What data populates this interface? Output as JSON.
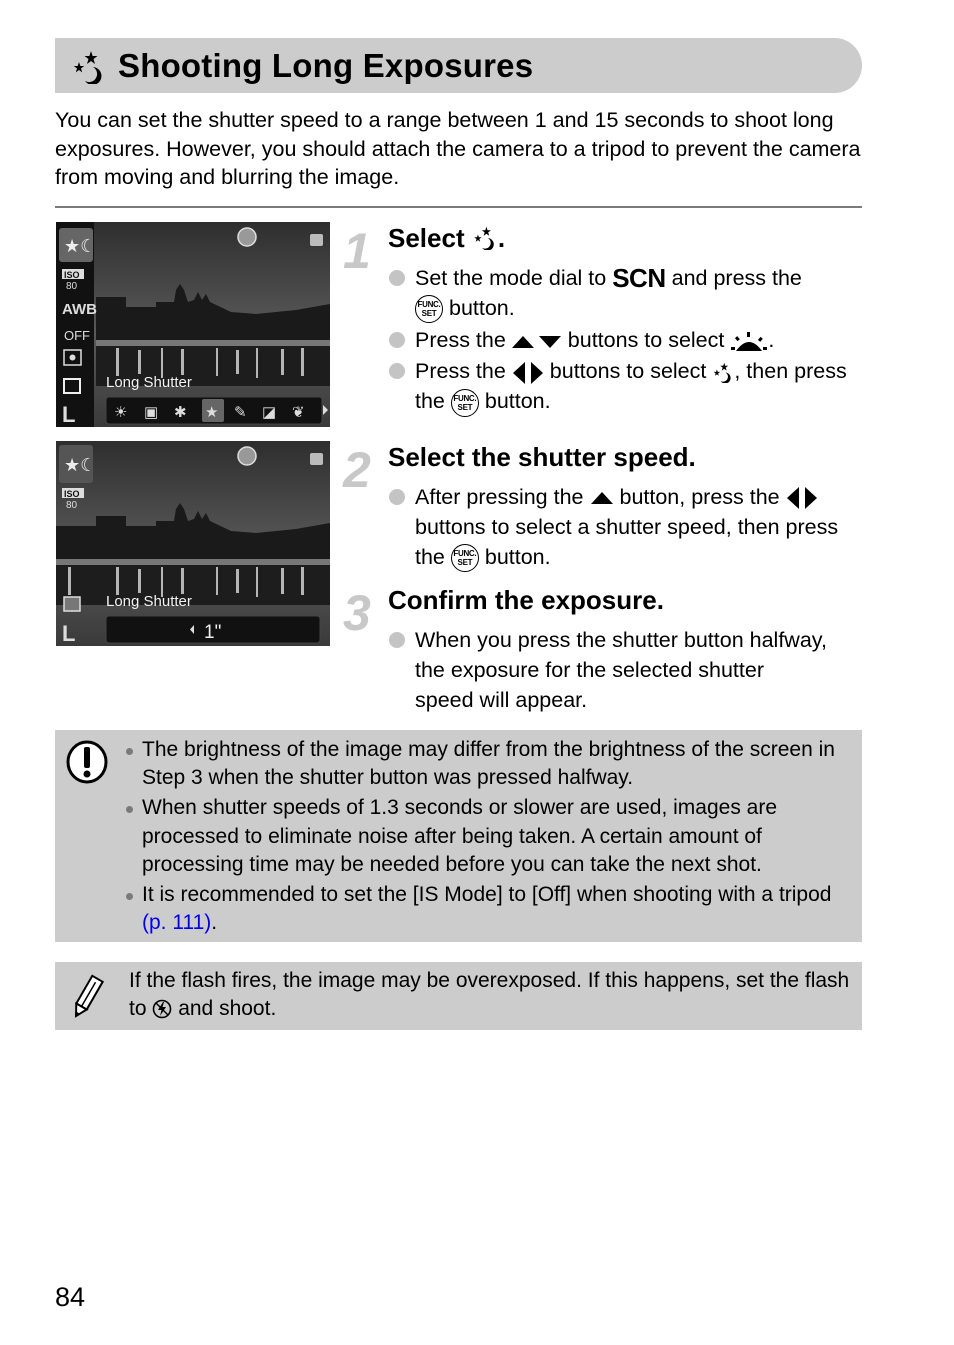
{
  "header": {
    "title_icon": "long-shutter-icon",
    "title": "Shooting Long Exposures"
  },
  "intro": "You can set the shutter speed to a range between 1 and 15 seconds to shoot long exposures. However, you should attach the camera to a tripod to prevent the camera from moving and blurring the image.",
  "screens": [
    {
      "mode_label": "Long Shutter",
      "left_icons": [
        "long-shutter-mode-icon",
        "iso-icon",
        "awb-icon",
        "my-colors-off-icon",
        "metering-icon",
        "drive-mode-icon",
        "image-size-icon"
      ],
      "iso_label": "ISO",
      "iso_value": "80",
      "awb_label": "AWB",
      "my_colors_label": "OFF",
      "size_label": "L",
      "scene_icons": [
        "sunset-icon",
        "portrait-icon",
        "fireworks-icon",
        "long-shutter-icon",
        "foliage-rain-icon",
        "aquarium-icon",
        "foliage-icon"
      ],
      "selected_scene": 3
    },
    {
      "mode_label": "Long Shutter",
      "iso_label": "ISO",
      "iso_value": "80",
      "size_label": "L",
      "shutter_value": "1\""
    }
  ],
  "steps": [
    {
      "number": "1",
      "title": "Select",
      "title_suffix": ".",
      "bullets": [
        {
          "parts": [
            "Set the mode dial to ",
            "SCN",
            " and press the ",
            "FUNC/SET",
            " button."
          ]
        },
        {
          "parts": [
            "Press the ",
            "up-down",
            " buttons to select ",
            "sunset",
            "."
          ]
        },
        {
          "parts": [
            "Press the ",
            "left-right",
            " buttons to select ",
            "long-shutter",
            ", then press the ",
            "FUNC/SET",
            " button."
          ]
        }
      ],
      "text": {
        "b1a": "Set the mode dial to",
        "b1_scn": "SCN",
        "b1b": "and press the",
        "b1c": "button.",
        "b2a": "Press the",
        "b2b": "buttons to select",
        "b2c": ".",
        "b3a": "Press the",
        "b3b": "buttons to select",
        "b3c": ", then press the",
        "b3d": "button."
      }
    },
    {
      "number": "2",
      "title": "Select the shutter speed.",
      "text": {
        "b1a": "After pressing the",
        "b1b": "button, press the",
        "b1c": "buttons to select a shutter speed, then press the",
        "b1d": "button."
      }
    },
    {
      "number": "3",
      "title": "Confirm the exposure.",
      "text": {
        "b1": "When you press the shutter button halfway, the exposure for the selected shutter speed will appear."
      }
    }
  ],
  "func_label_top": "FUNC.",
  "func_label_bottom": "SET",
  "caution": {
    "icon": "caution-icon",
    "items": [
      "The brightness of the image may differ from the brightness of the screen in Step 3 when the shutter button was pressed halfway.",
      "When shutter speeds of 1.3 seconds or slower are used, images are processed to eliminate noise after being taken. A certain amount of processing time may be needed before you can take the next shot.",
      "It is recommended to set the [IS Mode] to [Off] when shooting with a tripod"
    ],
    "link_text": "(p. 111)",
    "link_suffix": ".",
    "link_color": "#0000ee"
  },
  "note": {
    "icon": "pencil-icon",
    "text_a": "If the flash fires, the image may be overexposed. If this happens, set the flash to",
    "text_b": "and shoot."
  },
  "page_number": "84"
}
